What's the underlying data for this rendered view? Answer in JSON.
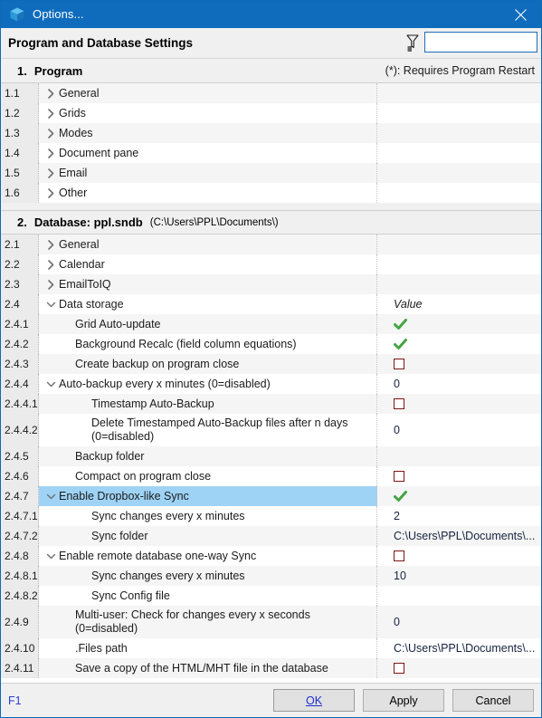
{
  "window": {
    "title": "Options...",
    "close_label": "×",
    "icon": "cube-icon",
    "accent": "#0f6cbd"
  },
  "header": {
    "heading": "Program and Database Settings",
    "filter_icon": "funnel-filter-icon",
    "filter_value": "",
    "filter_placeholder": ""
  },
  "sections": [
    {
      "number": "1.",
      "title": "Program",
      "subtitle": "",
      "note": "(*): Requires Program Restart"
    },
    {
      "number": "2.",
      "title": "Database: ppl.sndb",
      "subtitle": "(C:\\Users\\PPL\\Documents\\)",
      "note": ""
    }
  ],
  "rows": [
    {
      "num": "1.1",
      "label": "General",
      "chev": "right",
      "indent": 1,
      "value": "",
      "value_type": "none"
    },
    {
      "num": "1.2",
      "label": "Grids",
      "chev": "right",
      "indent": 1,
      "value": "",
      "value_type": "none"
    },
    {
      "num": "1.3",
      "label": "Modes",
      "chev": "right",
      "indent": 1,
      "value": "",
      "value_type": "none"
    },
    {
      "num": "1.4",
      "label": "Document pane",
      "chev": "right",
      "indent": 1,
      "value": "",
      "value_type": "none"
    },
    {
      "num": "1.5",
      "label": "Email",
      "chev": "right",
      "indent": 1,
      "value": "",
      "value_type": "none"
    },
    {
      "num": "1.6",
      "label": "Other",
      "chev": "right",
      "indent": 1,
      "value": "",
      "value_type": "none"
    },
    {
      "num": "2.1",
      "label": "General",
      "chev": "right",
      "indent": 1,
      "value": "",
      "value_type": "none"
    },
    {
      "num": "2.2",
      "label": "Calendar",
      "chev": "right",
      "indent": 1,
      "value": "",
      "value_type": "none"
    },
    {
      "num": "2.3",
      "label": "EmailToIQ",
      "chev": "right",
      "indent": 1,
      "value": "",
      "value_type": "none"
    },
    {
      "num": "2.4",
      "label": "Data storage",
      "chev": "down",
      "indent": 1,
      "value": "Value",
      "value_type": "header"
    },
    {
      "num": "2.4.1",
      "label": "Grid Auto-update",
      "chev": "none",
      "indent": 2,
      "value": "",
      "value_type": "check"
    },
    {
      "num": "2.4.2",
      "label": "Background Recalc (field column equations)",
      "chev": "none",
      "indent": 2,
      "value": "",
      "value_type": "check"
    },
    {
      "num": "2.4.3",
      "label": "Create backup on program close",
      "chev": "none",
      "indent": 2,
      "value": "",
      "value_type": "uncheck"
    },
    {
      "num": "2.4.4",
      "label": "Auto-backup every x minutes (0=disabled)",
      "chev": "down",
      "indent": 1,
      "value": "0",
      "value_type": "text"
    },
    {
      "num": "2.4.4.1",
      "label": "Timestamp Auto-Backup",
      "chev": "none",
      "indent": 3,
      "value": "",
      "value_type": "uncheck"
    },
    {
      "num": "2.4.4.2",
      "label": "Delete Timestamped Auto-Backup files after n days\n(0=disabled)",
      "chev": "none",
      "indent": 3,
      "value": "0",
      "value_type": "text",
      "tall": true
    },
    {
      "num": "2.4.5",
      "label": "Backup folder",
      "chev": "none",
      "indent": 2,
      "value": "",
      "value_type": "none"
    },
    {
      "num": "2.4.6",
      "label": "Compact on program close",
      "chev": "none",
      "indent": 2,
      "value": "",
      "value_type": "uncheck"
    },
    {
      "num": "2.4.7",
      "label": "Enable Dropbox-like Sync",
      "chev": "down",
      "indent": 1,
      "value": "",
      "value_type": "check",
      "selected": true
    },
    {
      "num": "2.4.7.1",
      "label": "Sync changes every x minutes",
      "chev": "none",
      "indent": 3,
      "value": "2",
      "value_type": "text"
    },
    {
      "num": "2.4.7.2",
      "label": "Sync folder",
      "chev": "none",
      "indent": 3,
      "value": "C:\\Users\\PPL\\Documents\\...",
      "value_type": "text"
    },
    {
      "num": "2.4.8",
      "label": "Enable remote database one-way Sync",
      "chev": "down",
      "indent": 1,
      "value": "",
      "value_type": "uncheck"
    },
    {
      "num": "2.4.8.1",
      "label": "Sync changes every x minutes",
      "chev": "none",
      "indent": 3,
      "value": "10",
      "value_type": "text"
    },
    {
      "num": "2.4.8.2",
      "label": "Sync Config file",
      "chev": "none",
      "indent": 3,
      "value": "",
      "value_type": "none"
    },
    {
      "num": "2.4.9",
      "label": "Multi-user: Check for changes every x seconds\n(0=disabled)",
      "chev": "none",
      "indent": 2,
      "value": "0",
      "value_type": "text",
      "tall": true
    },
    {
      "num": "2.4.10",
      "label": ".Files path",
      "chev": "none",
      "indent": 2,
      "value": "C:\\Users\\PPL\\Documents\\...",
      "value_type": "text"
    },
    {
      "num": "2.4.11",
      "label": "Save a copy of the HTML/MHT file in the database",
      "chev": "none",
      "indent": 2,
      "value": "",
      "value_type": "uncheck"
    }
  ],
  "footer": {
    "hint": "F1",
    "buttons": [
      {
        "label": "OK",
        "mnemonic": "O",
        "default": true
      },
      {
        "label": "Apply",
        "mnemonic": "A",
        "default": false
      },
      {
        "label": "Cancel",
        "mnemonic": "C",
        "default": false
      }
    ]
  },
  "colors": {
    "title_bar": "#0f6cbd",
    "selection": "#9fd3f5",
    "check_green": "#44a544",
    "checkbox_red": "#7b1616",
    "hint_blue": "#2b3ed6"
  }
}
